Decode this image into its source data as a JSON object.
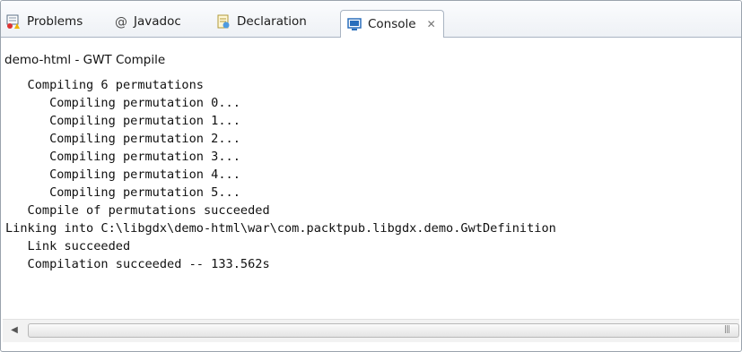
{
  "tabs": [
    {
      "label": "Problems",
      "icon": "problems-icon"
    },
    {
      "label": "Javadoc",
      "icon": "javadoc-icon"
    },
    {
      "label": "Declaration",
      "icon": "declaration-icon"
    },
    {
      "label": "Console",
      "icon": "console-icon",
      "active": true
    }
  ],
  "console": {
    "title": "demo-html - GWT Compile",
    "lines": [
      "   Compiling 6 permutations",
      "      Compiling permutation 0...",
      "      Compiling permutation 1...",
      "      Compiling permutation 2...",
      "      Compiling permutation 3...",
      "      Compiling permutation 4...",
      "      Compiling permutation 5...",
      "   Compile of permutations succeeded",
      "Linking into C:\\libgdx\\demo-html\\war\\com.packtpub.libgdx.demo.GwtDefinition",
      "   Link succeeded",
      "   Compilation succeeded -- 133.562s"
    ]
  },
  "colors": {
    "accent": "#2a6ebb",
    "border": "#a9b4c2"
  }
}
